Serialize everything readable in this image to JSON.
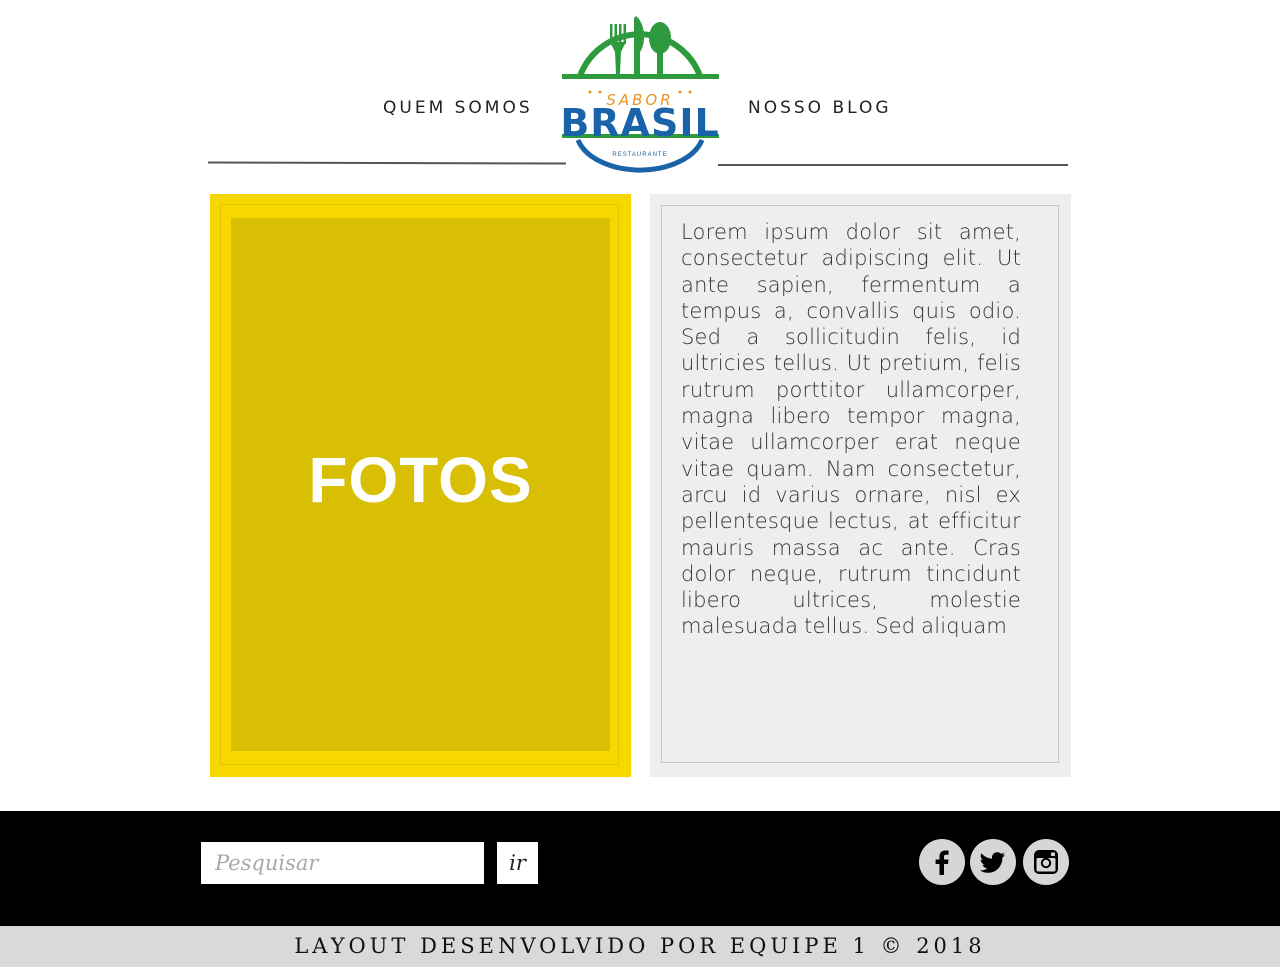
{
  "nav": {
    "left_label": "QUEM SOMOS",
    "right_label": "NOSSO BLOG"
  },
  "logo": {
    "top_text": "SABOR",
    "main_text": "BRASIL",
    "bottom_text": "RESTAURANTE",
    "colors": {
      "green": "#2e9a3e",
      "blue": "#1a63a8",
      "orange": "#e8941f"
    }
  },
  "photos": {
    "label": "FOTOS",
    "colors": {
      "outer": "#f6d800",
      "inner": "#d9bf04"
    }
  },
  "content": {
    "text": "Lorem ipsum dolor sit amet, consectetur adipiscing elit. Ut ante sapien, fermentum a tempus a, convallis quis odio. Sed a sollicitudin felis, id ultricies tellus. Ut pretium, felis rutrum porttitor ullamcorper, magna libero tempor magna, vitae ullamcorper erat neque vitae quam. Nam consectetur, arcu id varius ornare, nisl ex pellentesque lectus, at efficitur mauris massa ac ante. Cras dolor neque, rutrum tincidunt libero ultrices, molestie malesuada tellus. Sed aliquam"
  },
  "footer": {
    "search": {
      "placeholder": "Pesquisar",
      "value": ""
    },
    "search_button_label": "ir",
    "social": [
      {
        "icon": "facebook-icon"
      },
      {
        "icon": "twitter-icon"
      },
      {
        "icon": "instagram-icon"
      }
    ],
    "copyright": "LAYOUT DESENVOLVIDO POR EQUIPE 1 © 2018"
  }
}
